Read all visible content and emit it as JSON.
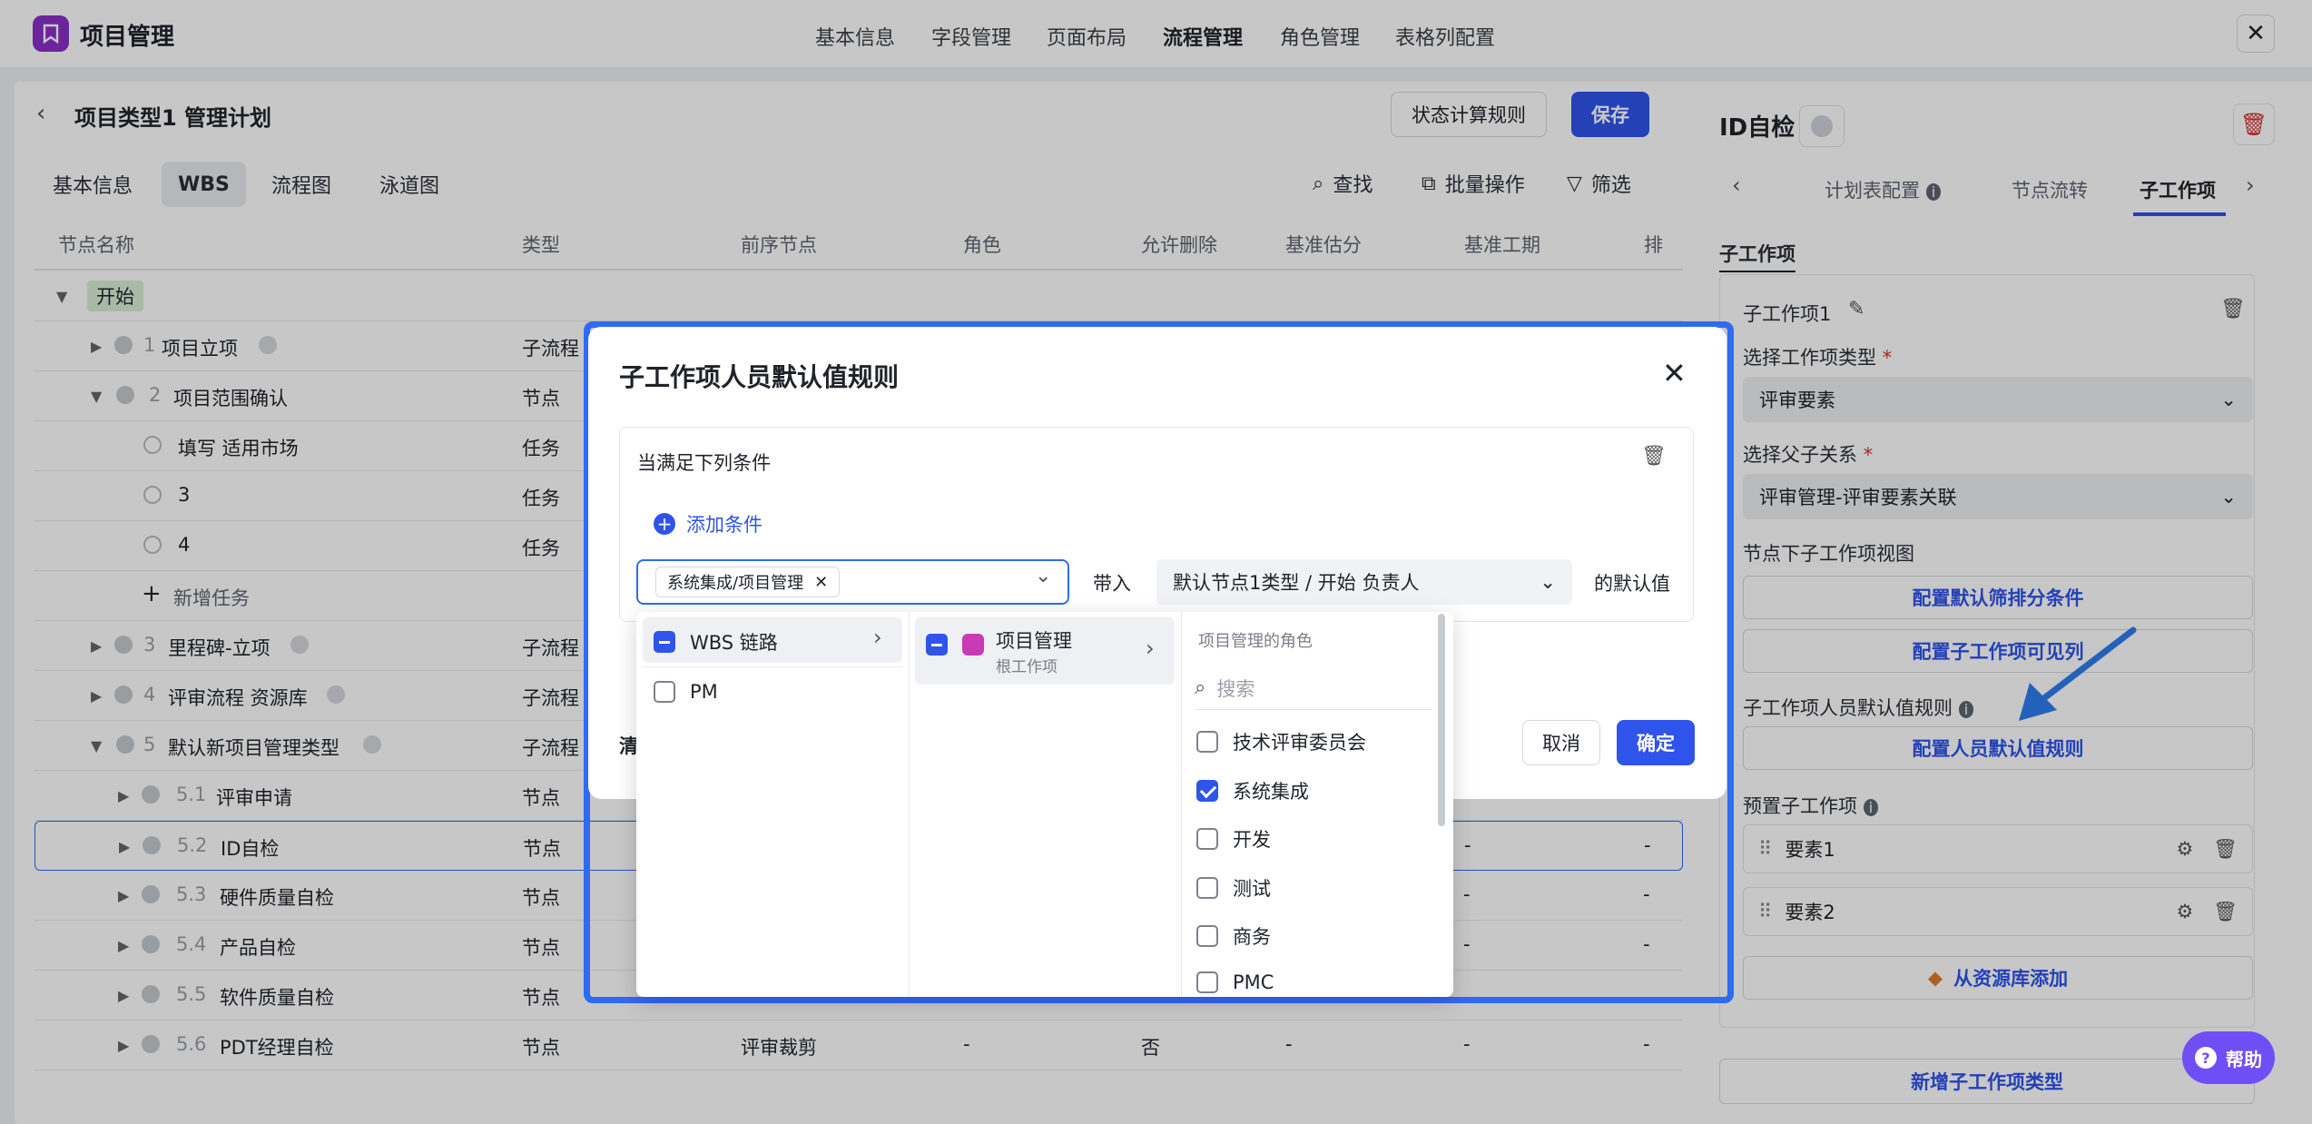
{
  "app": {
    "title": "项目管理"
  },
  "top_tabs": [
    "基本信息",
    "字段管理",
    "页面布局",
    "流程管理",
    "角色管理",
    "表格列配置"
  ],
  "page": {
    "title": "项目类型1 管理计划",
    "btn_rules": "状态计算规则",
    "btn_save": "保存"
  },
  "sub_tabs": [
    "基本信息",
    "WBS",
    "流程图",
    "泳道图"
  ],
  "tools": {
    "find": "查找",
    "batch": "批量操作",
    "filter": "筛选"
  },
  "columns": [
    "节点名称",
    "类型",
    "前序节点",
    "角色",
    "允许删除",
    "基准估分",
    "基准工期",
    "排"
  ],
  "rows": [
    {
      "num": "",
      "name": "开始",
      "type": "",
      "prev": "",
      "role": "",
      "del": "",
      "est": "",
      "dur": "",
      "last": ""
    },
    {
      "num": "1",
      "name": "项目立项",
      "type": "子流程",
      "prev": "",
      "role": "",
      "del": "",
      "est": "",
      "dur": "",
      "last": ""
    },
    {
      "num": "2",
      "name": "项目范围确认",
      "type": "节点",
      "prev": "",
      "role": "",
      "del": "",
      "est": "",
      "dur": "",
      "last": ""
    },
    {
      "num": "",
      "name": "填写 适用市场",
      "type": "任务",
      "prev": "",
      "role": "",
      "del": "",
      "est": "",
      "dur": "",
      "last": ""
    },
    {
      "num": "",
      "name": "3",
      "type": "任务",
      "prev": "",
      "role": "",
      "del": "",
      "est": "",
      "dur": "",
      "last": ""
    },
    {
      "num": "",
      "name": "4",
      "type": "任务",
      "prev": "",
      "role": "",
      "del": "",
      "est": "",
      "dur": "",
      "last": ""
    },
    {
      "num": "",
      "name": "新增任务",
      "type": "",
      "prev": "",
      "role": "",
      "del": "",
      "est": "",
      "dur": "",
      "last": ""
    },
    {
      "num": "3",
      "name": "里程碑-立项",
      "type": "子流程",
      "prev": "",
      "role": "",
      "del": "",
      "est": "",
      "dur": "",
      "last": ""
    },
    {
      "num": "4",
      "name": "评审流程 资源库",
      "type": "子流程",
      "prev": "",
      "role": "",
      "del": "",
      "est": "",
      "dur": "",
      "last": ""
    },
    {
      "num": "5",
      "name": "默认新项目管理类型",
      "type": "子流程",
      "prev": "",
      "role": "",
      "del": "",
      "est": "",
      "dur": "",
      "last": ""
    },
    {
      "num": "5.1",
      "name": "评审申请",
      "type": "节点",
      "prev": "",
      "role": "",
      "del": "",
      "est": "",
      "dur": "",
      "last": ""
    },
    {
      "num": "5.2",
      "name": "ID自检",
      "type": "节点",
      "prev": "",
      "role": "",
      "del": "",
      "est": "",
      "dur": "-",
      "last": "-"
    },
    {
      "num": "5.3",
      "name": "硬件质量自检",
      "type": "节点",
      "prev": "",
      "role": "",
      "del": "",
      "est": "",
      "dur": "-",
      "last": "-"
    },
    {
      "num": "5.4",
      "name": "产品自检",
      "type": "节点",
      "prev": "",
      "role": "",
      "del": "",
      "est": "",
      "dur": "-",
      "last": "-"
    },
    {
      "num": "5.5",
      "name": "软件质量自检",
      "type": "节点",
      "prev": "",
      "role": "",
      "del": "",
      "est": "",
      "dur": "-",
      "last": "-"
    },
    {
      "num": "5.6",
      "name": "PDT经理自检",
      "type": "节点",
      "prev": "评审裁剪",
      "role": "-",
      "del": "否",
      "est": "-",
      "dur": "-",
      "last": "-"
    }
  ],
  "right": {
    "title": "ID自检",
    "tabs": [
      "计划表配置",
      "节点流转",
      "子工作项"
    ],
    "section": "子工作项",
    "item_name": "子工作项1",
    "type_label": "选择工作项类型",
    "type_value": "评审要素",
    "parent_label": "选择父子关系",
    "parent_value": "评审管理-评审要素关联",
    "view_label": "节点下子工作项视图",
    "btn_filter": "配置默认筛排分条件",
    "btn_visible": "配置子工作项可见列",
    "rule_label": "子工作项人员默认值规则",
    "btn_rule": "配置人员默认值规则",
    "preset_label": "预置子工作项",
    "presets": [
      "要素1",
      "要素2"
    ],
    "btn_lib": "从资源库添加",
    "btn_new_type": "新增子工作项类型"
  },
  "modal": {
    "title": "子工作项人员默认值规则",
    "cond_label": "当满足下列条件",
    "add_cond": "添加条件",
    "tag": "系统集成/项目管理",
    "bring": "带入",
    "node_select": "默认节点1类型 / 开始 负责人",
    "default_suffix": "的默认值",
    "clear_stub": "清",
    "cancel": "取消",
    "ok": "确定"
  },
  "cascader": {
    "col1": [
      "WBS 链路",
      "PM"
    ],
    "col2_title": "项目管理",
    "col2_sub": "根工作项",
    "col3_header": "项目管理的角色",
    "search_placeholder": "搜索",
    "roles": [
      {
        "name": "技术评审委员会",
        "checked": false
      },
      {
        "name": "系统集成",
        "checked": true
      },
      {
        "name": "开发",
        "checked": false
      },
      {
        "name": "测试",
        "checked": false
      },
      {
        "name": "商务",
        "checked": false
      },
      {
        "name": "PMC",
        "checked": false
      }
    ]
  },
  "help": "帮助",
  "colors": {
    "primary": "#2f54eb",
    "highlight": "#2f6bf2",
    "logo": "#8b2fc9",
    "help": "#6e4ff5",
    "start_chip": "#d8efd6"
  }
}
